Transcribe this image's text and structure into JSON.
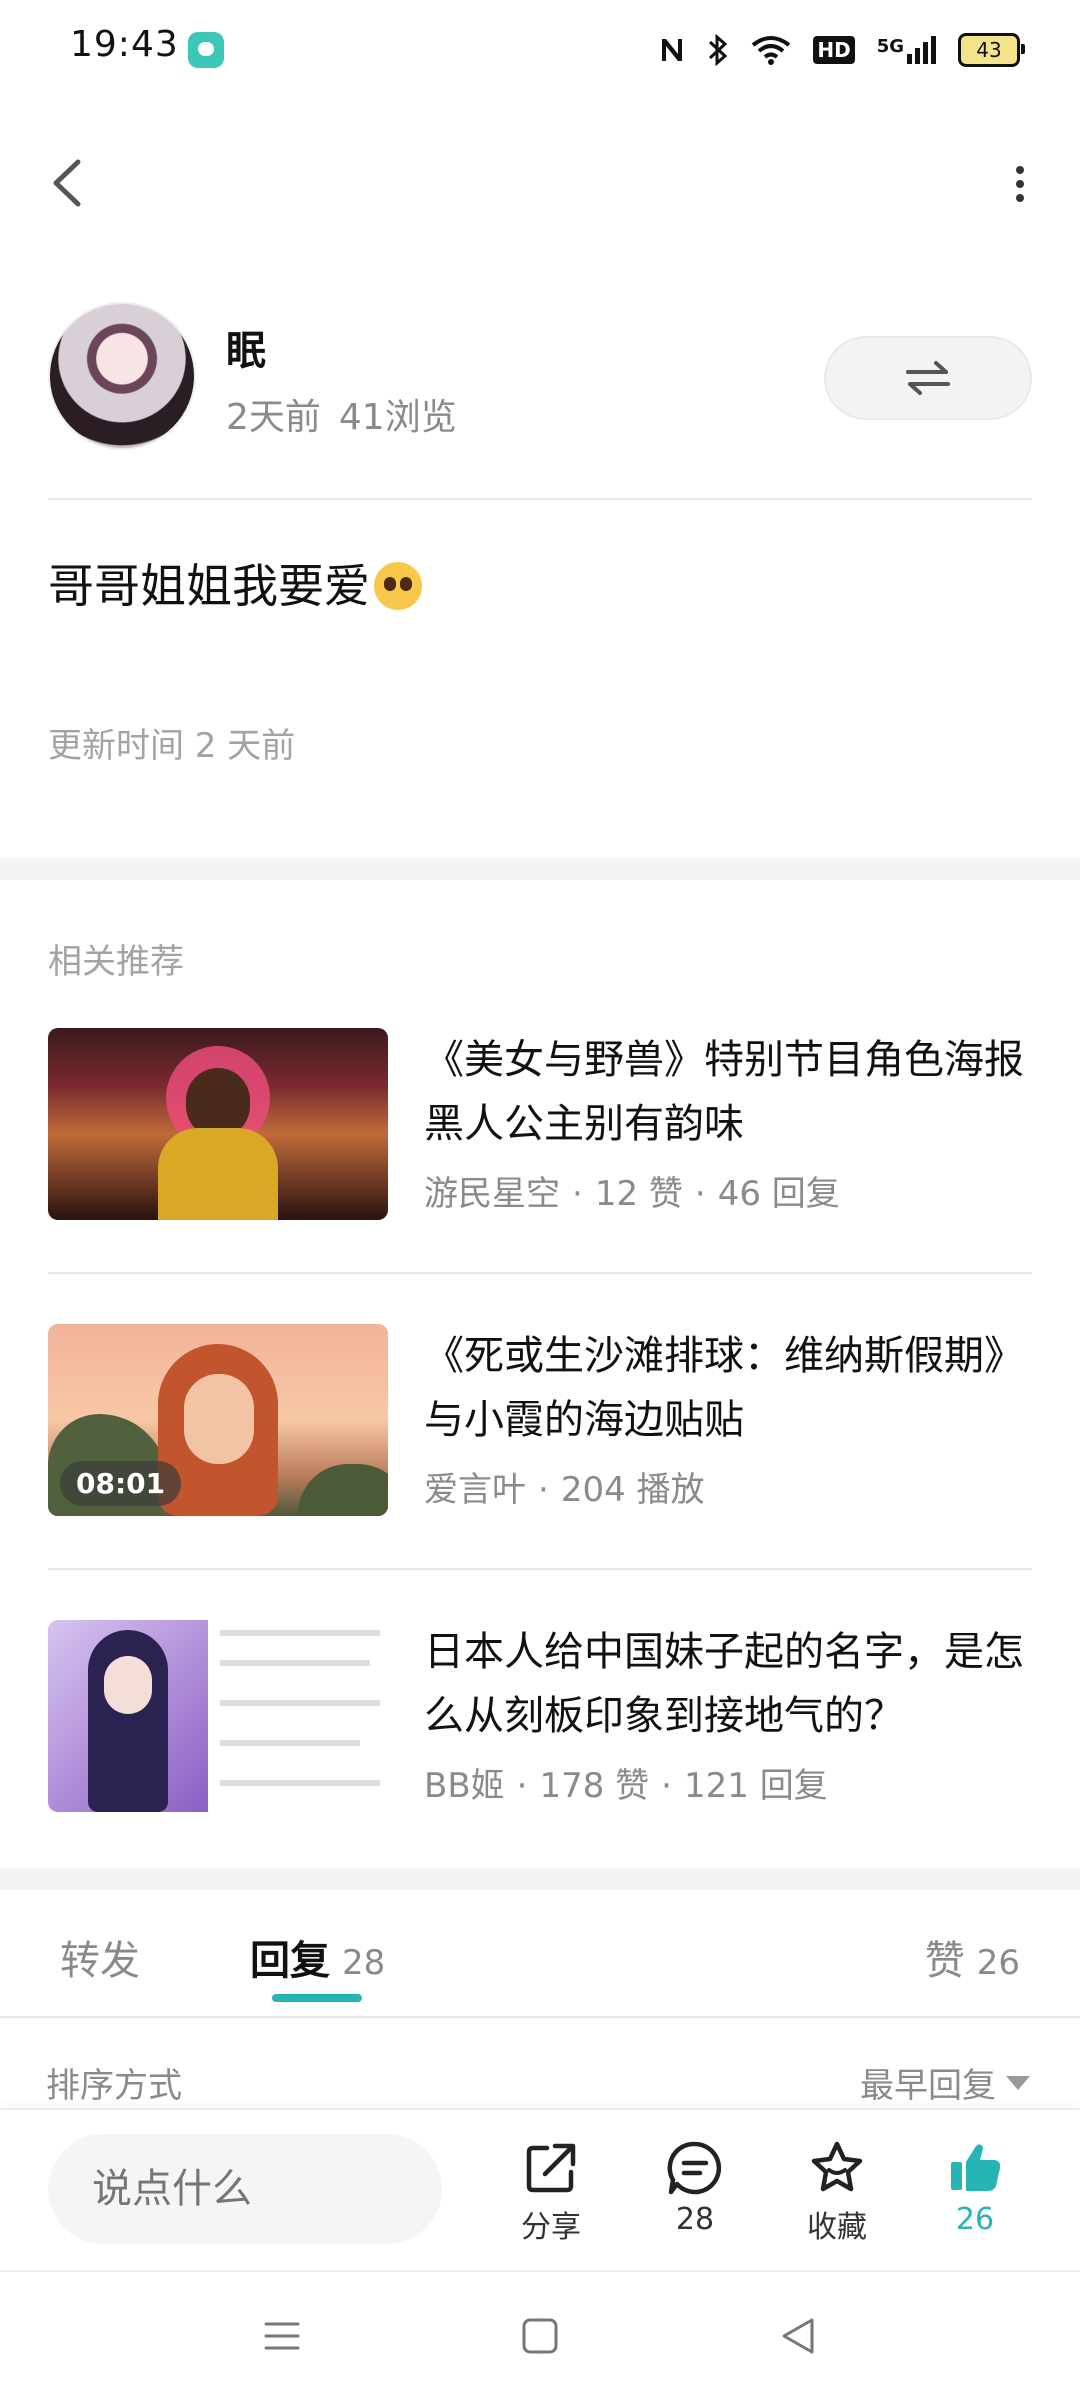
{
  "status_bar": {
    "time": "19:43",
    "app_icon": "chat-app-icon",
    "icons": [
      "nfc-icon",
      "bluetooth-icon",
      "wifi-icon",
      "hd-icon",
      "signal-5g-icon",
      "battery-icon"
    ],
    "hd_label": "HD",
    "network_label": "5G",
    "battery_level": "43"
  },
  "header": {
    "back_icon": "chevron-left-icon",
    "more_icon": "more-vertical-icon"
  },
  "author": {
    "name": "眠",
    "time_ago": "2天前",
    "views": "41浏览",
    "switch_icon": "swap-icon"
  },
  "post": {
    "text": "哥哥姐姐我要爱",
    "emoji": "pleading-face-emoji",
    "update_time": "更新时间 2 天前"
  },
  "related": {
    "title": "相关推荐",
    "items": [
      {
        "title": "《美女与野兽》特别节目角色海报 黑人公主别有韵味",
        "author": "游民星空",
        "stat1": "12 赞",
        "stat2": "46 回复"
      },
      {
        "title": "《死或生沙滩排球：维纳斯假期》与小霞的海边贴贴",
        "author": "爱言叶",
        "stat1": "204 播放",
        "duration": "08:01"
      },
      {
        "title": "日本人给中国妹子起的名字，是怎么从刻板印象到接地气的？",
        "author": "BB姬",
        "stat1": "178 赞",
        "stat2": "121 回复"
      }
    ]
  },
  "tabs": {
    "repost": "转发",
    "reply": "回复",
    "reply_count": "28",
    "like": "赞",
    "like_count": "26"
  },
  "sort": {
    "label": "排序方式",
    "value": "最早回复"
  },
  "action_bar": {
    "input_placeholder": "说点什么",
    "share": "分享",
    "comment_count": "28",
    "collect": "收藏",
    "like_count": "26",
    "accent_color": "#27b4b4"
  },
  "nav_bar": {
    "icons": [
      "menu-icon",
      "home-icon",
      "back-triangle-icon"
    ]
  }
}
